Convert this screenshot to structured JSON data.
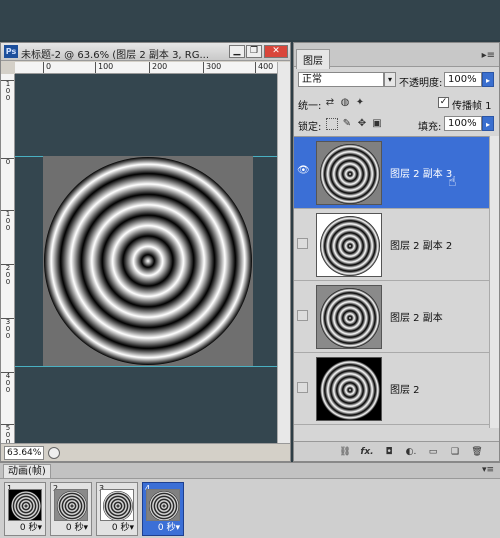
{
  "document": {
    "title": "未标题-2 @ 63.6% (图层 2 副本 3, RG...",
    "ps_logo": "Ps",
    "zoom": "63.64%",
    "ruler_h": [
      "0",
      "100",
      "200",
      "300",
      "400"
    ],
    "ruler_v": [
      "1\n0\n0",
      "0",
      "1\n0\n0",
      "2\n0\n0",
      "3\n0\n0",
      "4\n0\n0",
      "5\n0\n0"
    ],
    "window_buttons": {
      "minimize": "▁",
      "restore": "❐",
      "close": "✕"
    }
  },
  "layers_panel": {
    "tab": "图层",
    "menu_icon": "▸≡",
    "blend_mode": "正常",
    "opacity_label": "不透明度:",
    "opacity_value": "100%",
    "unify_label": "统一:",
    "propagate_label": "传播帧 1",
    "propagate_checked": "✓",
    "lock_label": "锁定:",
    "fill_label": "填充:",
    "fill_value": "100%",
    "layers": [
      {
        "name": "图层 2 副本 3",
        "visible": "👁",
        "selected": true,
        "bg": "#808080"
      },
      {
        "name": "图层 2 副本 2",
        "visible": "",
        "selected": false,
        "bg": "#ffffff"
      },
      {
        "name": "图层 2 副本",
        "visible": "",
        "selected": false,
        "bg": "#8a8a8a"
      },
      {
        "name": "图层 2",
        "visible": "",
        "selected": false,
        "bg": "#000000"
      }
    ],
    "footer_icons": [
      "link-icon",
      "fx-icon",
      "mask-icon",
      "adjustment-icon",
      "group-icon",
      "new-layer-icon",
      "trash-icon"
    ],
    "footer_glyphs": [
      "⛓",
      "fx.",
      "◘",
      "◐.",
      "▭",
      "❑",
      "🗑"
    ]
  },
  "animation_panel": {
    "title": "动画(帧)",
    "menu_icon": "▾≡",
    "frames": [
      {
        "num": "1",
        "delay": "0 秒▾",
        "bg": "#000000"
      },
      {
        "num": "2",
        "delay": "0 秒▾",
        "bg": "#8a8a8a"
      },
      {
        "num": "3",
        "delay": "0 秒▾",
        "bg": "#ffffff"
      },
      {
        "num": "4",
        "delay": "0 秒▾",
        "bg": "#808080"
      }
    ]
  },
  "colors": {
    "selection": "#3b6fd6",
    "guide": "#4fc3d6",
    "canvas_bg": "#34464f"
  }
}
